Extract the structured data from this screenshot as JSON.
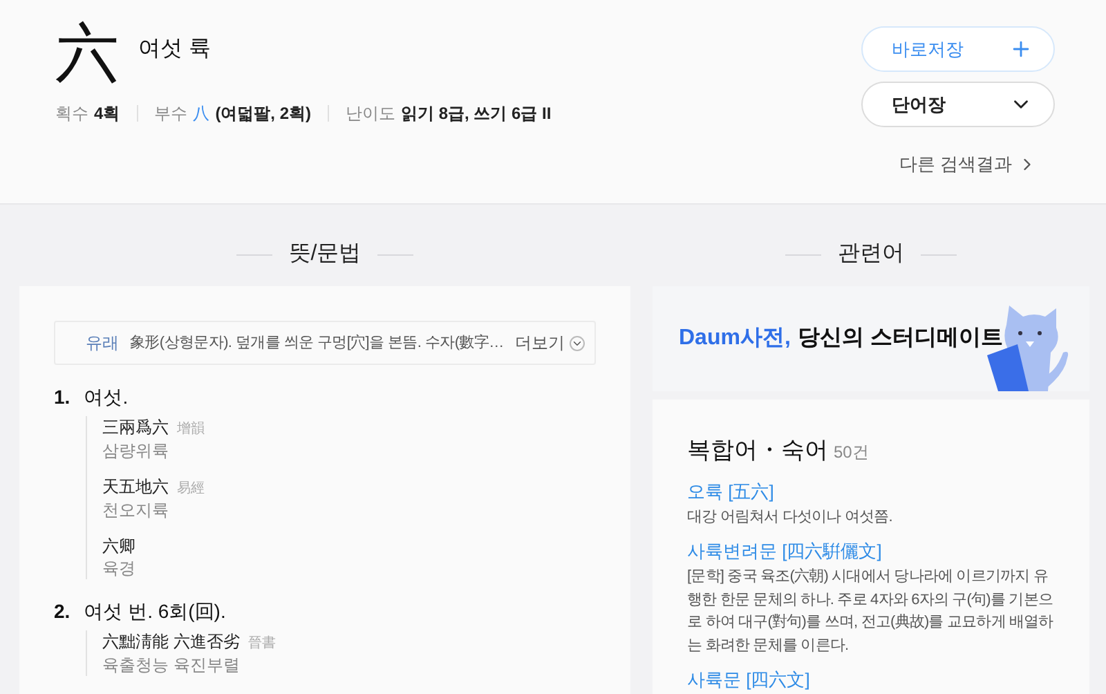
{
  "header": {
    "hanja": "六",
    "reading": "여섯 륙",
    "meta": [
      {
        "kind": "plain",
        "label": "획수",
        "value": "4획"
      },
      {
        "kind": "radical",
        "label": "부수",
        "radical": "八",
        "value": "(여덟팔, 2획)"
      },
      {
        "kind": "plain",
        "label": "난이도",
        "value": "읽기 8급, 쓰기 6급 II"
      }
    ],
    "save_button": "바로저장",
    "wordbook_button": "단어장",
    "other_results": "다른 검색결과"
  },
  "meaning": {
    "title": "뜻/문법",
    "origin": {
      "label": "유래",
      "text": "象形(상형문자). 덮개를 씌운 구멍[穴]을 본뜸. 수자(數字…",
      "more": "더보기"
    },
    "items": [
      {
        "number": "1.",
        "text": "여섯.",
        "examples": [
          {
            "hanja": "三兩爲六",
            "source": "增韻",
            "reading": "삼량위륙"
          },
          {
            "hanja": "天五地六",
            "source": "易經",
            "reading": "천오지륙"
          },
          {
            "hanja": "六卿",
            "reading": "육경"
          }
        ]
      },
      {
        "number": "2.",
        "text": "여섯 번. 6회(回).",
        "examples": [
          {
            "hanja": "六黜淸能 六進否劣",
            "source": "晉書",
            "reading": "육출청능 육진부렬"
          }
        ]
      }
    ]
  },
  "related": {
    "title": "관련어",
    "banner": {
      "brand": "Daum사전,",
      "text": "당신의 스터디메이트"
    },
    "compound": {
      "title": "복합어・숙어",
      "count": "50건",
      "entries": [
        {
          "word": "오륙 [五六]",
          "definition": "대강 어림쳐서 다섯이나 여섯쯤."
        },
        {
          "word": "사륙변려문 [四六騈儷文]",
          "definition": "[문학] 중국 육조(六朝) 시대에서 당나라에 이르기까지 유행한 한문 문체의 하나. 주로 4자와 6자의 구(句)를 기본으로 하여 대구(對句)를 쓰며, 전고(典故)를 교묘하게 배열하는 화려한 문체를 이른다."
        },
        {
          "word": "사륙문 [四六文]"
        }
      ]
    }
  }
}
